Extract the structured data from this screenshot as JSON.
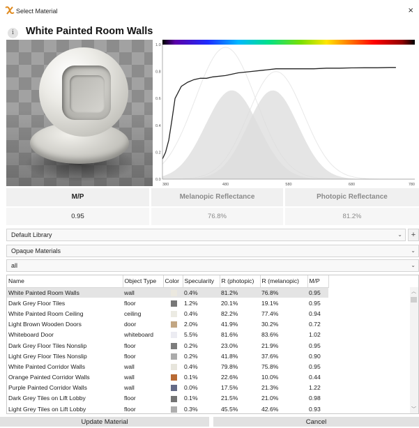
{
  "window": {
    "title": "Select Material",
    "close_glyph": "×"
  },
  "header": {
    "info_glyph": "i",
    "material_name": "White Painted Room Walls"
  },
  "chart_data": {
    "type": "area",
    "x_range": [
      380,
      780
    ],
    "y_range": [
      0,
      1.0
    ],
    "x_ticks": [
      "380",
      "480",
      "580",
      "680",
      "780"
    ],
    "y_ticks": [
      "0.0",
      "0.2",
      "0.4",
      "0.6",
      "0.8",
      "1.0"
    ],
    "reflectance": {
      "x": [
        380,
        385,
        390,
        395,
        400,
        410,
        420,
        430,
        440,
        450,
        460,
        480,
        500,
        520,
        540,
        560,
        580,
        600,
        620,
        640,
        660,
        680,
        700,
        720,
        740,
        750
      ],
      "y": [
        0.15,
        0.2,
        0.29,
        0.44,
        0.6,
        0.69,
        0.72,
        0.74,
        0.75,
        0.75,
        0.76,
        0.77,
        0.79,
        0.8,
        0.81,
        0.82,
        0.82,
        0.82,
        0.82,
        0.825,
        0.825,
        0.827,
        0.828,
        0.828,
        0.83,
        0.83
      ]
    },
    "melanopic": {
      "peak_x": 490,
      "peak_y": 0.66,
      "sigma": 42
    },
    "photopic": {
      "peak_x": 555,
      "peak_y": 0.66,
      "sigma": 40
    },
    "melanopic_outline": {
      "peak_x": 480,
      "peak_y": 0.98,
      "sigma": 48
    },
    "photopic_outline": {
      "peak_x": 560,
      "peak_y": 0.8,
      "sigma": 44
    },
    "colors": {
      "reflectance": "#222222",
      "fill": "#dcdcdc",
      "outline": "#e8e8e8"
    }
  },
  "metrics": {
    "mp_label": "M/P",
    "mp_value": "0.95",
    "melanopic_label": "Melanopic Reflectance",
    "melanopic_value": "76.8%",
    "photopic_label": "Photopic Reflectance",
    "photopic_value": "81.2%"
  },
  "filters": {
    "library": "Default Library",
    "category": "Opaque Materials",
    "subset": "all",
    "add_label": "+",
    "chevron": "⌄"
  },
  "table": {
    "columns": [
      "Name",
      "Object Type",
      "Color",
      "Specularity",
      "R (photopic)",
      "R (melanopic)",
      "M/P"
    ],
    "rows": [
      {
        "name": "White Painted Room Walls",
        "type": "wall",
        "color": "#ebe8df",
        "spec": "0.4%",
        "rp": "81.2%",
        "rm": "76.8%",
        "mp": "0.95"
      },
      {
        "name": "Dark Grey Floor Tiles",
        "type": "floor",
        "color": "#777777",
        "spec": "1.2%",
        "rp": "20.1%",
        "rm": "19.1%",
        "mp": "0.95"
      },
      {
        "name": "White Painted Room Ceiling",
        "type": "ceiling",
        "color": "#ecebe3",
        "spec": "0.4%",
        "rp": "82.2%",
        "rm": "77.4%",
        "mp": "0.94"
      },
      {
        "name": "Light Brown Wooden Doors",
        "type": "door",
        "color": "#c2a683",
        "spec": "2.0%",
        "rp": "41.9%",
        "rm": "30.2%",
        "mp": "0.72"
      },
      {
        "name": "Whiteboard Door",
        "type": "whiteboard",
        "color": "#ececf2",
        "spec": "5.5%",
        "rp": "81.6%",
        "rm": "83.6%",
        "mp": "1.02"
      },
      {
        "name": "Dark Grey Floor Tiles Nonslip",
        "type": "floor",
        "color": "#7c7c7c",
        "spec": "0.2%",
        "rp": "23.0%",
        "rm": "21.9%",
        "mp": "0.95"
      },
      {
        "name": "Light Grey Floor Tiles Nonslip",
        "type": "floor",
        "color": "#ababab",
        "spec": "0.2%",
        "rp": "41.8%",
        "rm": "37.6%",
        "mp": "0.90"
      },
      {
        "name": "White Painted Corridor Walls",
        "type": "wall",
        "color": "#e7e5dc",
        "spec": "0.4%",
        "rp": "79.8%",
        "rm": "75.8%",
        "mp": "0.95"
      },
      {
        "name": "Orange Painted Corridor Walls",
        "type": "wall",
        "color": "#b86a34",
        "spec": "0.1%",
        "rp": "22.6%",
        "rm": "10.0%",
        "mp": "0.44"
      },
      {
        "name": "Purple Painted Corridor Walls",
        "type": "wall",
        "color": "#646a86",
        "spec": "0.0%",
        "rp": "17.5%",
        "rm": "21.3%",
        "mp": "1.22"
      },
      {
        "name": "Dark Grey Tiles on Lift Lobby",
        "type": "floor",
        "color": "#747474",
        "spec": "0.1%",
        "rp": "21.5%",
        "rm": "21.0%",
        "mp": "0.98"
      },
      {
        "name": "Light Grey Tiles on Lift Lobby",
        "type": "floor",
        "color": "#adadad",
        "spec": "0.3%",
        "rp": "45.5%",
        "rm": "42.6%",
        "mp": "0.93"
      }
    ]
  },
  "buttons": {
    "update": "Update Material",
    "cancel": "Cancel"
  }
}
